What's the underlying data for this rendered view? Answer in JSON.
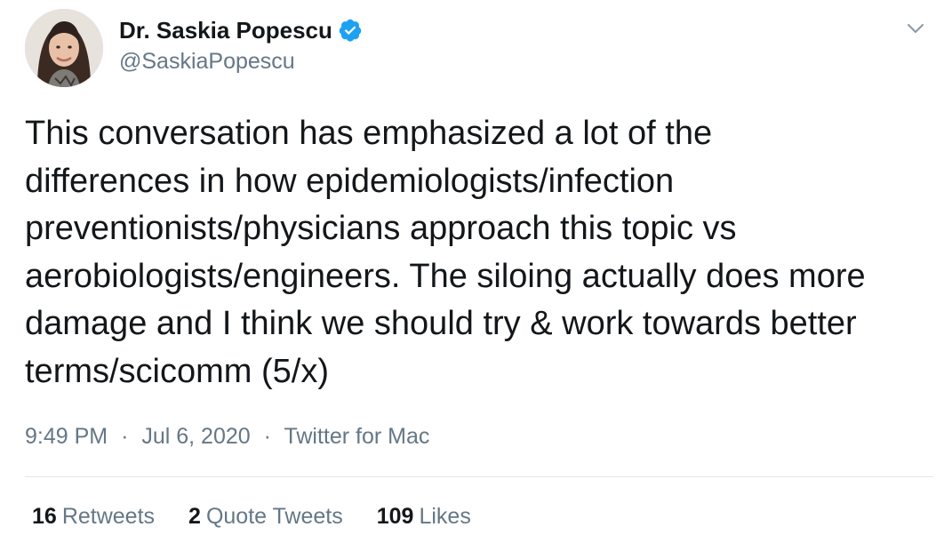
{
  "author": {
    "display_name": "Dr. Saskia Popescu",
    "handle": "@SaskiaPopescu",
    "verified": true,
    "avatar_icon": "profile-photo"
  },
  "tweet": {
    "lines": [
      "This conversation has emphasized a lot of the",
      "differences in how epidemiologists/infection",
      "preventionists/physicians approach this topic vs",
      "aerobiologists/engineers. The siloing actually does more",
      "damage and I think we should try & work towards better",
      "terms/scicomm (5/x)"
    ]
  },
  "meta": {
    "time": "9:49 PM",
    "date": "Jul 6, 2020",
    "separator": "·",
    "source": "Twitter for Mac"
  },
  "stats": {
    "retweets_count": "16",
    "retweets_label": "Retweets",
    "quotes_count": "2",
    "quotes_label": "Quote Tweets",
    "likes_count": "109",
    "likes_label": "Likes"
  },
  "colors": {
    "text": "#14171a",
    "secondary": "#657786",
    "verified_blue": "#1da1f2",
    "divider": "#e1e8ed"
  }
}
